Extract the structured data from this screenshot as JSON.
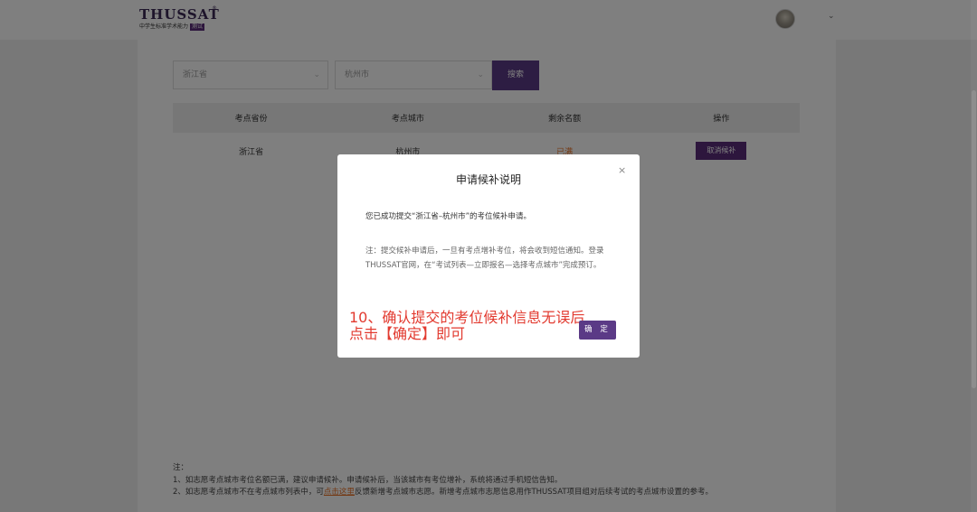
{
  "header": {
    "logo_text": "THUSSAT",
    "logo_reg": "®",
    "logo_subtitle": "中学生标准学术能力",
    "logo_badge": "测试",
    "avatar_icon": "user-avatar",
    "menu_icon": "chevron-down-icon"
  },
  "filters": {
    "province": "浙江省",
    "city": "杭州市",
    "search_label": "搜索"
  },
  "table": {
    "headers": [
      "考点省份",
      "考点城市",
      "剩余名额",
      "操作"
    ],
    "rows": [
      {
        "province": "浙江省",
        "city": "杭州市",
        "remaining": "已满",
        "action": "取消候补"
      }
    ]
  },
  "notes": {
    "title": "注：",
    "line1": "1、如志愿考点城市考位名额已满，建议申请候补。申请候补后，当该城市有考位增补，系统将通过手机短信告知。",
    "line2_before": "2、如志愿考点城市不在考点城市列表中，可",
    "line2_link": "点击这里",
    "line2_after": "反馈新增考点城市志愿。新增考点城市志愿信息用作THUSSAT项目组对后续考试的考点城市设置的参考。"
  },
  "modal": {
    "title": "申请候补说明",
    "close_icon": "close-icon",
    "message": "您已成功提交“浙江省–杭州市”的考位候补申请。",
    "note": "注：提交候补申请后，一旦有考点增补考位，将会收到短信通知。登录THUSSAT官网，在“考试列表—立即报名—选择考点城市”完成预订。",
    "annotation_line1": "10、确认提交的考位候补信息无误后",
    "annotation_line2": "点击【确定】即可",
    "confirm_label": "确 定"
  },
  "colors": {
    "brand_purple": "#5b3a86",
    "status_orange": "#e8752b",
    "annotation_red": "#e23a2f"
  }
}
